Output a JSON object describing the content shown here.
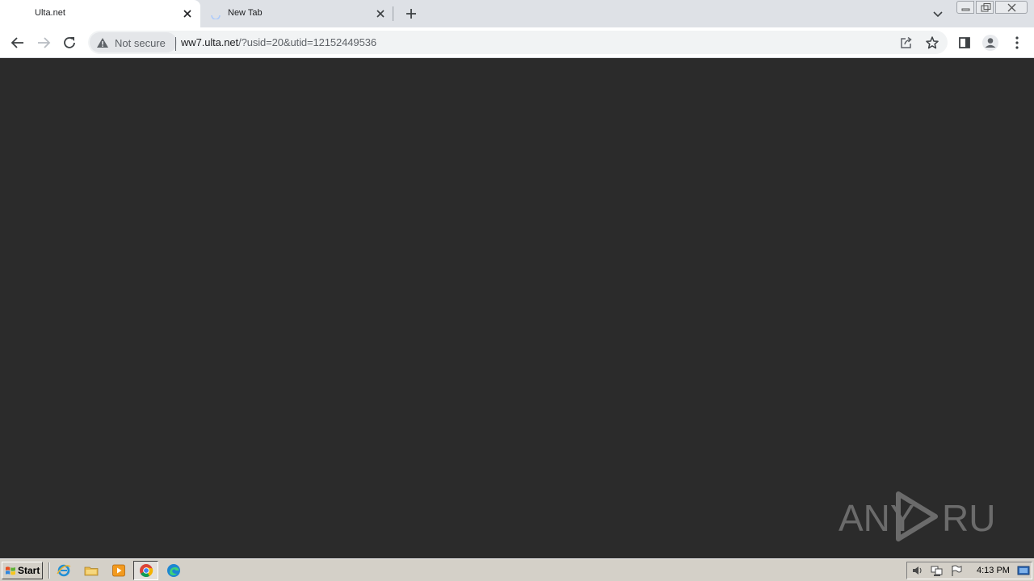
{
  "browser": {
    "tabs": [
      {
        "title": "Ulta.net",
        "active": true
      },
      {
        "title": "New Tab",
        "active": false,
        "loading": true
      }
    ],
    "security_label": "Not secure",
    "url_host": "ww7.ulta.net",
    "url_rest": "/?usid=20&utid=12152449536"
  },
  "watermark": {
    "text": "ANY RUN"
  },
  "taskbar": {
    "start_label": "Start",
    "clock": "4:13 PM"
  },
  "colors": {
    "content_bg": "#2b2b2b",
    "tabstrip_bg": "#dee1e6",
    "taskbar_bg": "#d4d0c8"
  }
}
